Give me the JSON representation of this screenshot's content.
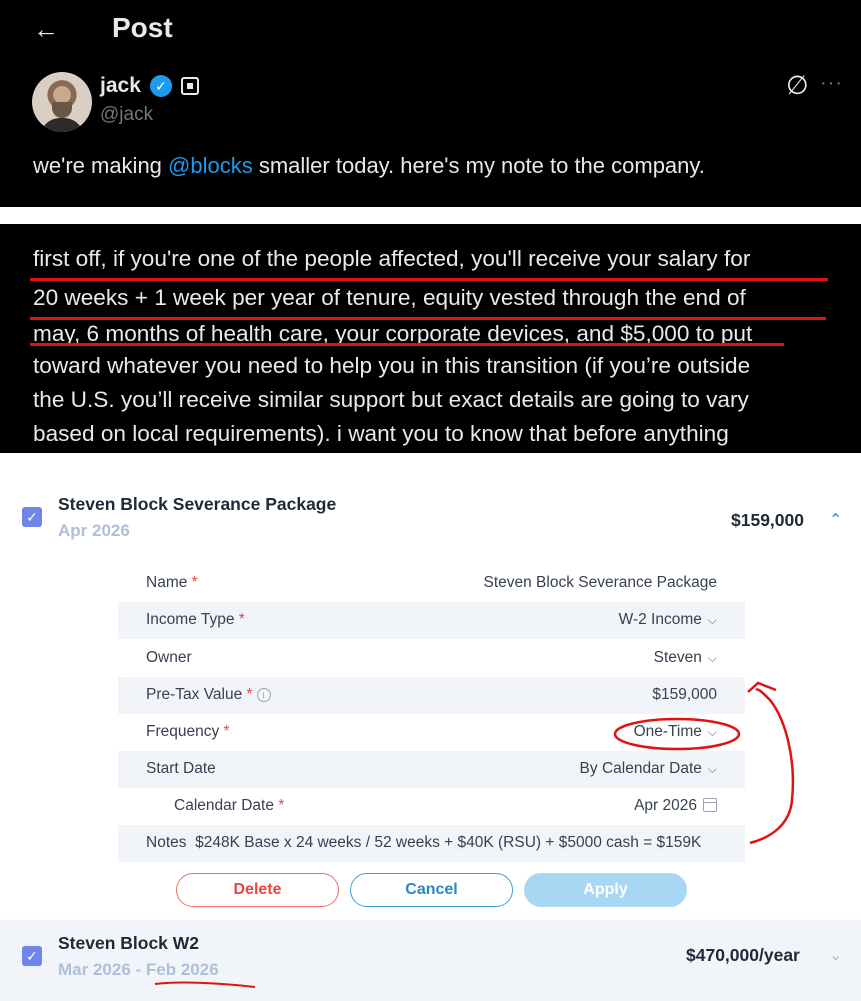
{
  "tweet": {
    "back_icon": "arrow-left-icon",
    "header_title": "Post",
    "author_name": "jack",
    "author_handle": "@jack",
    "text_before": "we're making ",
    "mention": "@blocks",
    "text_after": " smaller today. here's my note to the company.",
    "more_label": "···"
  },
  "note": {
    "lines": [
      "first off, if you're one of the people affected, you'll receive your salary for",
      "20 weeks + 1 week per year of tenure, equity vested through the end of",
      "may, 6 months of health care, your corporate devices, and $5,000 to put",
      "toward whatever you need to help you in this transition (if you’re outside",
      "the U.S. you’ll receive similar support but exact details are going to vary",
      "based on local requirements). i want you to know that before anything"
    ]
  },
  "planner": {
    "item1": {
      "title": "Steven Block Severance Package",
      "date": "Apr 2026",
      "amount": "$159,000",
      "fields": {
        "name_label": "Name",
        "name_value": "Steven Block Severance Package",
        "income_type_label": "Income Type",
        "income_type_value": "W-2 Income",
        "owner_label": "Owner",
        "owner_value": "Steven",
        "pretax_label": "Pre-Tax Value",
        "pretax_value": "$159,000",
        "frequency_label": "Frequency",
        "frequency_value": "One-Time",
        "start_date_label": "Start Date",
        "start_date_value": "By Calendar Date",
        "calendar_date_label": "Calendar Date",
        "calendar_date_value": "Apr 2026",
        "notes_label": "Notes",
        "notes_value": "$248K Base x 24 weeks / 52 weeks + $40K (RSU) + $5000 cash  = $159K"
      },
      "buttons": {
        "delete": "Delete",
        "cancel": "Cancel",
        "apply": "Apply"
      }
    },
    "item2": {
      "title": "Steven Block W2",
      "date": "Mar 2026 - Feb 2026",
      "amount": "$470,000/year"
    }
  },
  "colors": {
    "annotation_red": "#e01313",
    "accent_blue": "#3b82f6",
    "checkbox": "#6f86e8",
    "required": "#ef4444"
  }
}
